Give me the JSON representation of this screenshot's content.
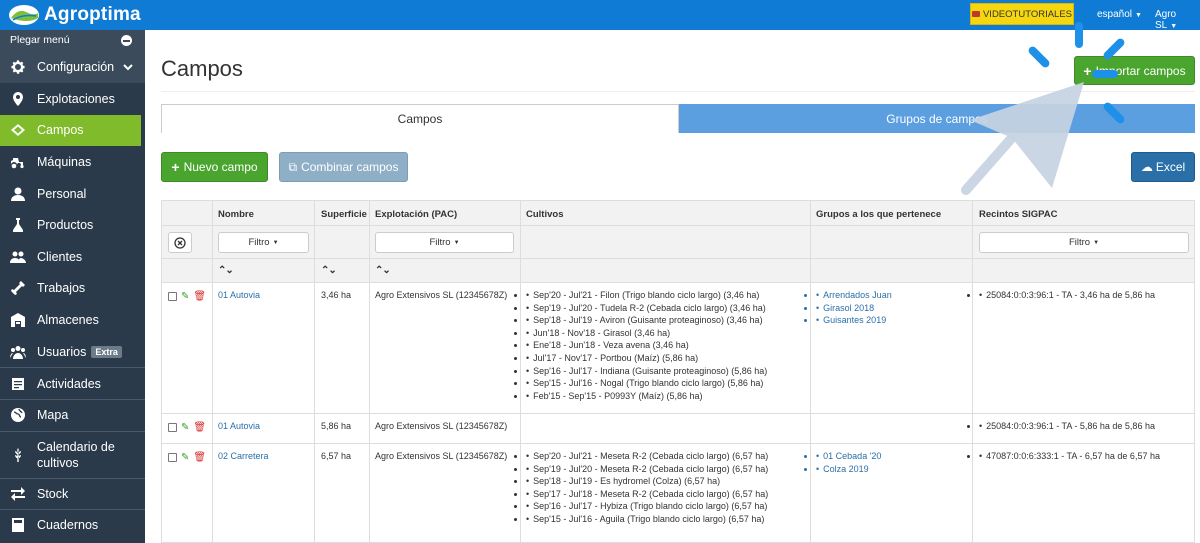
{
  "topbar": {
    "brand": "Agroptima",
    "video_label": "VIDEOTUTORIALES",
    "language": "español",
    "account": "Agro SL"
  },
  "sidebar": {
    "collapse_label": "Plegar menú",
    "items": [
      {
        "label": "Configuración",
        "icon": "gear-icon"
      },
      {
        "label": "Explotaciones",
        "icon": "map-pin-icon"
      },
      {
        "label": "Campos",
        "icon": "fields-icon"
      },
      {
        "label": "Máquinas",
        "icon": "tractor-icon"
      },
      {
        "label": "Personal",
        "icon": "user-icon"
      },
      {
        "label": "Productos",
        "icon": "flask-icon"
      },
      {
        "label": "Clientes",
        "icon": "users-icon"
      },
      {
        "label": "Trabajos",
        "icon": "tool-icon"
      },
      {
        "label": "Almacenes",
        "icon": "warehouse-icon"
      },
      {
        "label": "Usuarios",
        "icon": "group-icon",
        "badge": "Extra"
      },
      {
        "label": "Actividades",
        "icon": "clipboard-icon"
      },
      {
        "label": "Mapa",
        "icon": "globe-icon"
      },
      {
        "label": "Calendario de cultivos",
        "icon": "wheat-icon"
      },
      {
        "label": "Stock",
        "icon": "transfer-icon"
      },
      {
        "label": "Cuadernos",
        "icon": "notebook-icon"
      }
    ]
  },
  "page": {
    "title": "Campos",
    "import_label": "Importar campos",
    "tabs": [
      "Campos",
      "Grupos de campos"
    ],
    "new_label": "Nuevo campo",
    "combine_label": "Combinar campos",
    "excel_label": "Excel"
  },
  "table": {
    "headers": [
      "Nombre",
      "Superficie",
      "Explotación (PAC)",
      "Cultivos",
      "Grupos a los que pertenece",
      "Recintos SIGPAC"
    ],
    "filter_label": "Filtro",
    "rows": [
      {
        "name": "01 Autovia",
        "surface": "3,46 ha",
        "farm": "Agro Extensivos SL (12345678Z)",
        "crops": [
          "Sep'20 - Jul'21 - Filon (Trigo blando ciclo largo) (3,46 ha)",
          "Sep'19 - Jul'20 - Tudela R-2 (Cebada ciclo largo) (3,46 ha)",
          "Sep'18 - Jul'19 - Aviron (Guisante proteaginoso) (3,46 ha)",
          "Jun'18 - Nov'18 - Girasol (3,46 ha)",
          "Ene'18 - Jun'18 - Veza avena (3,46 ha)",
          "Jul'17 - Nov'17 - Portbou (Maíz) (5,86 ha)",
          "Sep'16 - Jul'17 - Indiana (Guisante proteaginoso) (5,86 ha)",
          "Sep'15 - Jul'16 - Nogal (Trigo blando ciclo largo) (5,86 ha)",
          "Feb'15 - Sep'15 - P0993Y (Maíz) (5,86 ha)"
        ],
        "groups": [
          "Arrendados Juan",
          "Girasol 2018",
          "Guisantes 2019"
        ],
        "sigpac": "25084:0:0:3:96:1 - TA - 3,46 ha de 5,86 ha"
      },
      {
        "name": "01 Autovia",
        "surface": "5,86 ha",
        "farm": "Agro Extensivos SL (12345678Z)",
        "crops": [],
        "groups": [],
        "sigpac": "25084:0:0:3:96:1 - TA - 5,86 ha de 5,86 ha"
      },
      {
        "name": "02 Carretera",
        "surface": "6,57 ha",
        "farm": "Agro Extensivos SL (12345678Z)",
        "crops": [
          "Sep'20 - Jul'21 - Meseta R-2 (Cebada ciclo largo) (6,57 ha)",
          "Sep'19 - Jul'20 - Meseta R-2 (Cebada ciclo largo) (6,57 ha)",
          "Sep'18 - Jul'19 - Es hydromel (Colza) (6,57 ha)",
          "Sep'17 - Jul'18 - Meseta R-2 (Cebada ciclo largo) (6,57 ha)",
          "Sep'16 - Jul'17 - Hybiza (Trigo blando ciclo largo) (6,57 ha)",
          "Sep'15 - Jul'16 - Aguila (Trigo blando ciclo largo) (6,57 ha)"
        ],
        "groups": [
          "01 Cebada '20",
          "Colza 2019"
        ],
        "sigpac": "47087:0:0:6:333:1 - TA - 6,57 ha de 6,57 ha"
      }
    ]
  },
  "colors": {
    "topbar": "#0f7bd4",
    "sidebar": "#2b3a4a",
    "active": "#80bb2b",
    "green_button": "#4aa52e",
    "link": "#2a6fa8",
    "video_button": "#f5d60f"
  }
}
